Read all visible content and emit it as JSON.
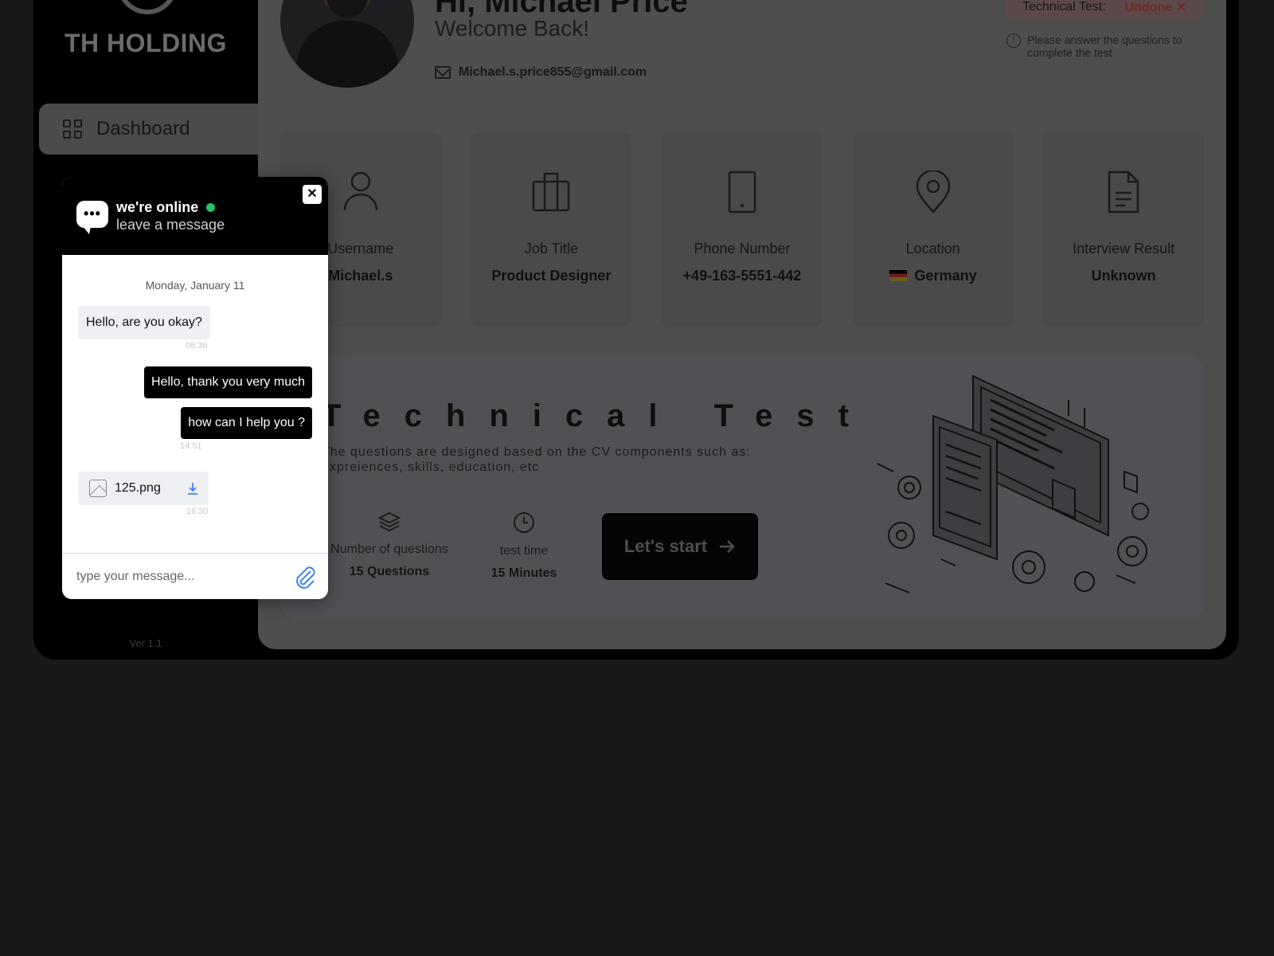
{
  "sidebar": {
    "brand": "TH HOLDING",
    "nav_dashboard": "Dashboard",
    "version": "Ver 1.1"
  },
  "profile": {
    "greeting": "Hi, Michael Price",
    "welcome": "Welcome Back!",
    "email": "Michael.s.price855@gmail.com"
  },
  "test_status": {
    "label": "Technical Test:",
    "value": "Undone ✕",
    "note": "Please answer the questions to complete the test"
  },
  "cards": [
    {
      "title": "Username",
      "value": "Michael.s",
      "icon": "user-icon"
    },
    {
      "title": "Job Title",
      "value": "Product Designer",
      "icon": "briefcase-icon"
    },
    {
      "title": "Phone Number",
      "value": "+49-163-5551-442",
      "icon": "phone-icon"
    },
    {
      "title": "Location",
      "value": "Germany",
      "icon": "location-pin-icon"
    },
    {
      "title": "Interview Result",
      "value": "Unknown",
      "icon": "document-icon"
    }
  ],
  "technical_test": {
    "title": "Technical Test",
    "description": "The questions are designed based on the CV components such as: expreiences, skills, education, etc",
    "questions_label": "Number of questions",
    "questions_value": "15 Questions",
    "time_label": "test time",
    "time_value": "15 Minutes",
    "start_button": "Let's start"
  },
  "chat": {
    "status": "we're online",
    "subtitle": "leave a message",
    "date": "Monday, January 11",
    "messages": [
      {
        "text": "Hello, are you okay?",
        "time": "08:36"
      },
      {
        "text": "Hello, thank you very much"
      },
      {
        "text": "how can I help you ?",
        "time": "14:51"
      }
    ],
    "file": {
      "name": "125.png",
      "time": "16:30"
    },
    "input_placeholder": "type your message...",
    "online_color": "#22c55e"
  }
}
